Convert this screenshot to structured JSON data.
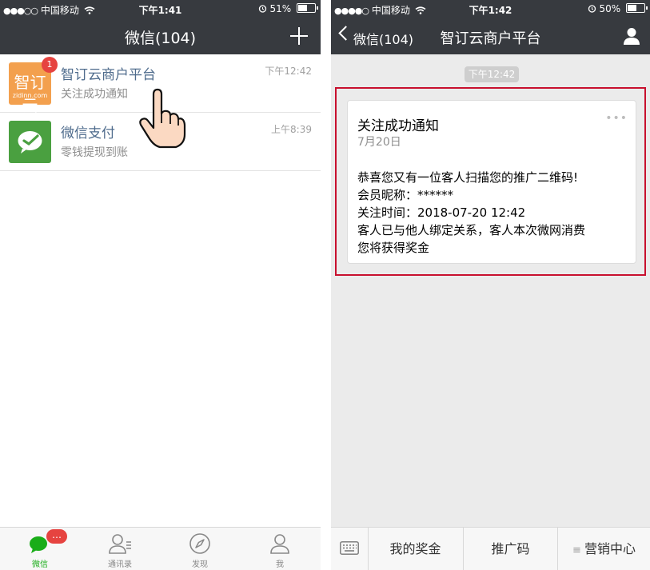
{
  "left_phone": {
    "status": {
      "signal": "●●●○○",
      "carrier": "中国移动",
      "time": "下午1:41",
      "battery": "51%",
      "battery_level": 0.51
    },
    "nav_title": "微信(104)",
    "chats": [
      {
        "avatar_line1": "智订云",
        "avatar_line2": "zidinn.com",
        "unread": "1",
        "title": "智订云商户平台",
        "subtitle": "关注成功通知",
        "time": "下午12:42"
      },
      {
        "title": "微信支付",
        "subtitle": "零钱提现到账",
        "time": "上午8:39"
      }
    ],
    "tabs": [
      {
        "label": "微信",
        "badge": "…"
      },
      {
        "label": "通讯录"
      },
      {
        "label": "发现"
      },
      {
        "label": "我"
      }
    ]
  },
  "right_phone": {
    "status": {
      "signal": "●●●●○",
      "carrier": "中国移动",
      "time": "下午1:42",
      "battery": "50%",
      "battery_level": 0.5
    },
    "back_label": "微信(104)",
    "nav_title": "智订云商户平台",
    "time_chip": "下午12:42",
    "card": {
      "title": "关注成功通知",
      "date": "7月20日",
      "more": "•••",
      "lines": [
        "恭喜您又有一位客人扫描您的推广二维码!",
        "会员昵称：******",
        "关注时间：2018-07-20 12:42",
        "客人已与他人绑定关系，客人本次微网消费",
        "您将获得奖金"
      ]
    },
    "menu": [
      {
        "label": "我的奖金"
      },
      {
        "label": "推广码"
      },
      {
        "label": "营销中心",
        "prefix": "≡"
      }
    ]
  },
  "colors": {
    "bar_dark": "#373a3f",
    "wechat_green": "#1aad19",
    "badge_red": "#e64340",
    "highlight_red": "#c8102e",
    "link_blue": "#4e6b8c"
  }
}
